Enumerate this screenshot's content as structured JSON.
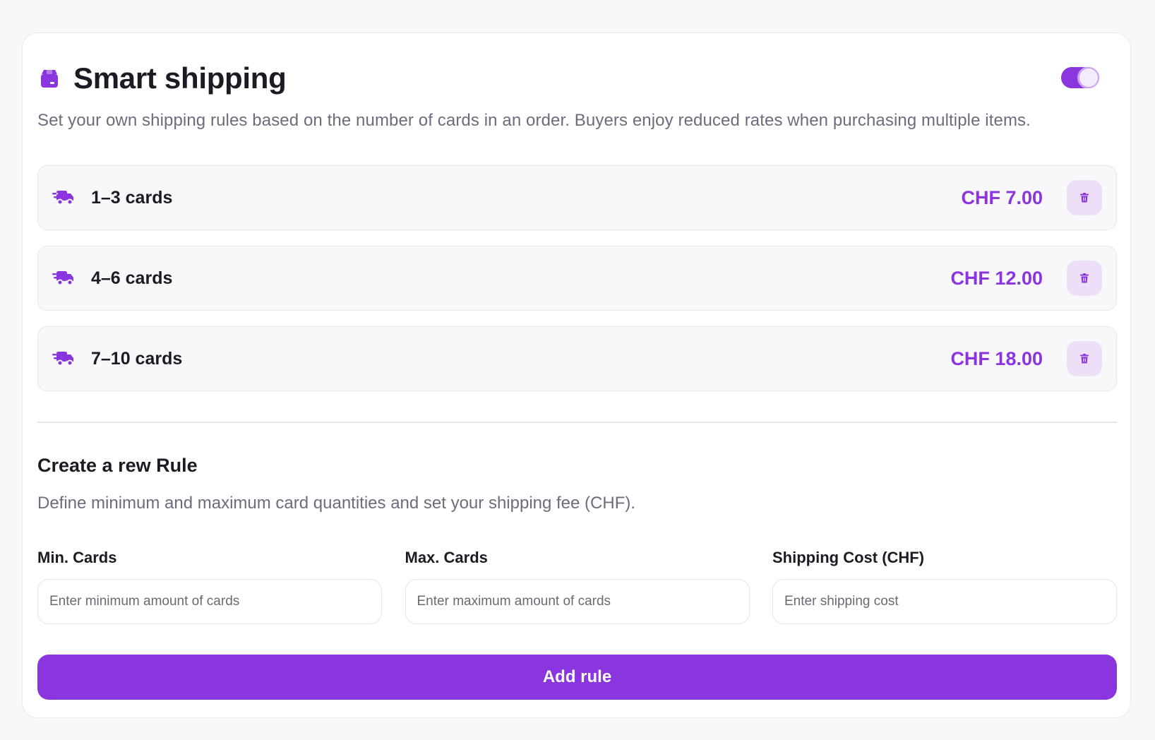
{
  "header": {
    "title": "Smart shipping",
    "icon": "package-icon",
    "toggle_state": true
  },
  "description": "Set your own shipping rules based on the number of cards in an order. Buyers enjoy reduced rates when purchasing multiple items.",
  "rules": [
    {
      "label": "1–3 cards",
      "price": "CHF 7.00",
      "icon": "delivery-truck-icon"
    },
    {
      "label": "4–6 cards",
      "price": "CHF 12.00",
      "icon": "delivery-truck-icon"
    },
    {
      "label": "7–10 cards",
      "price": "CHF 18.00",
      "icon": "delivery-truck-icon"
    }
  ],
  "new_rule": {
    "title": "Create a rew Rule",
    "description": "Define minimum and maximum card quantities and set your shipping fee (CHF).",
    "fields": [
      {
        "label": "Min. Cards",
        "placeholder": "Enter minimum amount of cards",
        "value": ""
      },
      {
        "label": "Max. Cards",
        "placeholder": "Enter maximum amount of cards",
        "value": ""
      },
      {
        "label": "Shipping Cost (CHF)",
        "placeholder": "Enter shipping cost",
        "value": ""
      }
    ],
    "submit_label": "Add rule"
  },
  "colors": {
    "accent": "#8a35de",
    "accent_soft": "#ecdff7",
    "muted_text": "#6f6b7d"
  }
}
